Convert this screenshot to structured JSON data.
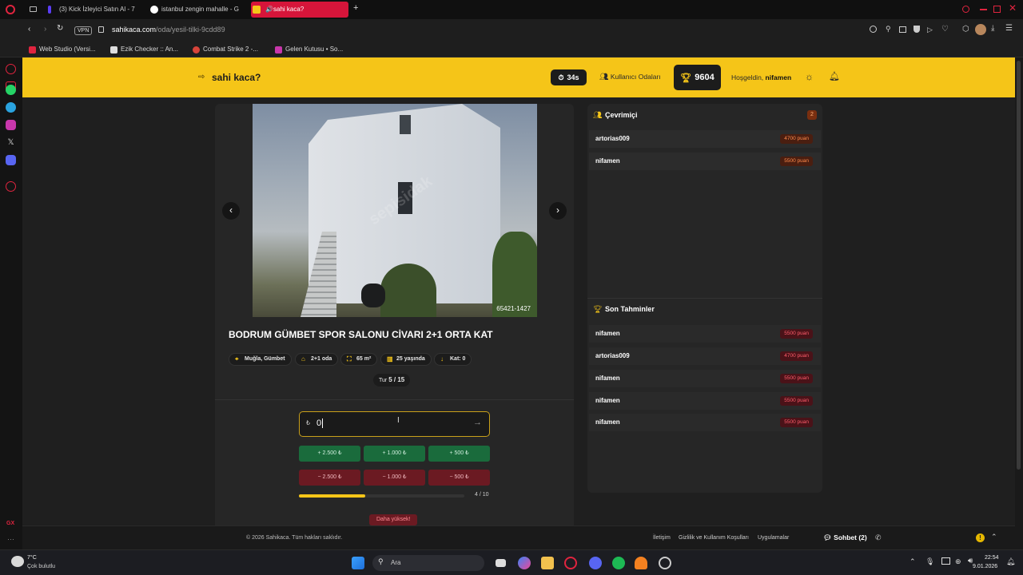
{
  "browser": {
    "tabs": [
      {
        "label": "(3) Kick İzleyici Satın Al - 7",
        "color": "#5b3df5"
      },
      {
        "label": "istanbul zengin mahalle - G",
        "color": "#4285f4"
      },
      {
        "label": "sahi kaca?",
        "color": "#f5c518"
      }
    ],
    "new_tab": "+",
    "url_domain": "sahikaca.com",
    "url_path": "/oda/yesil-tilki-9cdd89",
    "vpn": "VPN",
    "bookmarks": [
      "Web Studio (Versi...",
      "Ezik Checker :: An...",
      "Combat Strike 2 -...",
      "Gelen Kutusu • So..."
    ]
  },
  "header": {
    "brand": "sahi kaca?",
    "timer": "34s",
    "user_rooms": "Kullanıcı Odaları",
    "score": "9604",
    "welcome_prefix": "Hoşgeldin,",
    "welcome_user": "nifamen"
  },
  "listing": {
    "image_id": "65421-1427",
    "watermark": "sepisidak",
    "title": "BODRUM GÜMBET SPOR SALONU CİVARI 2+1 ORTA KAT",
    "chips": [
      "Muğla, Gümbet",
      "2+1 oda",
      "65 m²",
      "25 yaşında",
      "Kat: 0"
    ],
    "round_label": "Tur",
    "round_value": "5 / 15"
  },
  "guess": {
    "currency": "₺",
    "value": "0",
    "plus_buttons": [
      "+ 2.500 ₺",
      "+ 1.000 ₺",
      "+ 500 ₺"
    ],
    "minus_buttons": [
      "− 2.500 ₺",
      "− 1.000 ₺",
      "− 500 ₺"
    ],
    "progress": 0.4,
    "progress_label": "4 / 10",
    "hint": "Daha yüksek!"
  },
  "online": {
    "title": "Çevrimiçi",
    "count": "2",
    "users": [
      {
        "name": "artorias009",
        "points": "4700 puan"
      },
      {
        "name": "nifamen",
        "points": "5500 puan"
      }
    ]
  },
  "recent": {
    "title": "Son Tahminler",
    "items": [
      {
        "name": "nifamen",
        "points": "5500 puan"
      },
      {
        "name": "artorias009",
        "points": "4700 puan"
      },
      {
        "name": "nifamen",
        "points": "5500 puan"
      },
      {
        "name": "nifamen",
        "points": "5500 puan"
      },
      {
        "name": "nifamen",
        "points": "5500 puan"
      }
    ]
  },
  "footer": {
    "copyright": "© 2026 Sahikaca. Tüm hakları saklıdır.",
    "links": [
      "İletişim",
      "Gizlilik ve Kullanım Koşulları",
      "Uygulamalar"
    ],
    "chat": "Sohbet (2)"
  },
  "taskbar": {
    "temp": "7°C",
    "weather": "Çok bulutlu",
    "search": "Ara",
    "time": "22:54",
    "date": "9.01.2026"
  }
}
